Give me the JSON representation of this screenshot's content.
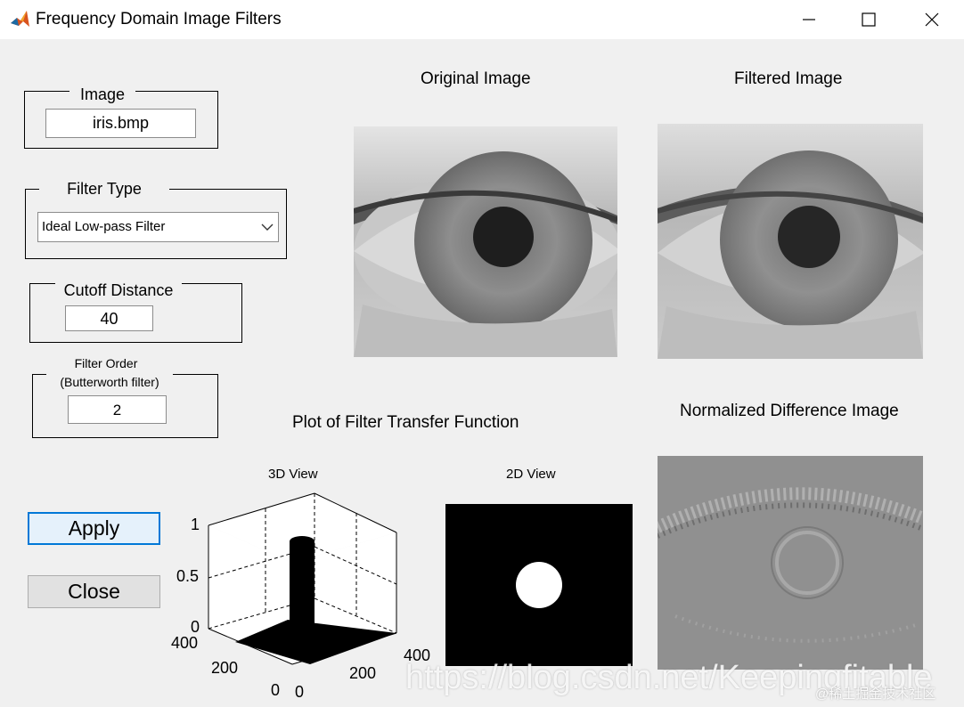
{
  "window": {
    "title": "Frequency Domain Image Filters",
    "controls": [
      "minimize-icon",
      "maximize-icon",
      "close-icon"
    ]
  },
  "panel": {
    "image_group": {
      "label": "Image",
      "value": "iris.bmp"
    },
    "filter_type_group": {
      "label": "Filter Type",
      "selected": "Ideal Low-pass Filter"
    },
    "cutoff_group": {
      "label": "Cutoff Distance",
      "value": "40"
    },
    "order_group": {
      "label_line1": "Filter Order",
      "label_line2": "(Butterworth filter)",
      "value": "2"
    },
    "apply_label": "Apply",
    "close_label": "Close"
  },
  "views": {
    "original_title": "Original Image",
    "filtered_title": "Filtered Image",
    "transfer_title": "Plot of Filter Transfer Function",
    "difference_title": "Normalized Difference Image",
    "view3d_title": "3D View",
    "view2d_title": "2D View"
  },
  "chart_data": {
    "type": "surface",
    "title": "3D View",
    "zlim": [
      0,
      1
    ],
    "z_ticks": [
      "1",
      "0.5",
      "0"
    ],
    "y_ticks": [
      "400",
      "200",
      "0"
    ],
    "x_ticks": [
      "0",
      "200",
      "400"
    ],
    "cutoff": 40
  },
  "watermark": {
    "main": "https://blog.csdn.net/Keepingfitable",
    "sub": "@稀土掘金技术社区"
  }
}
